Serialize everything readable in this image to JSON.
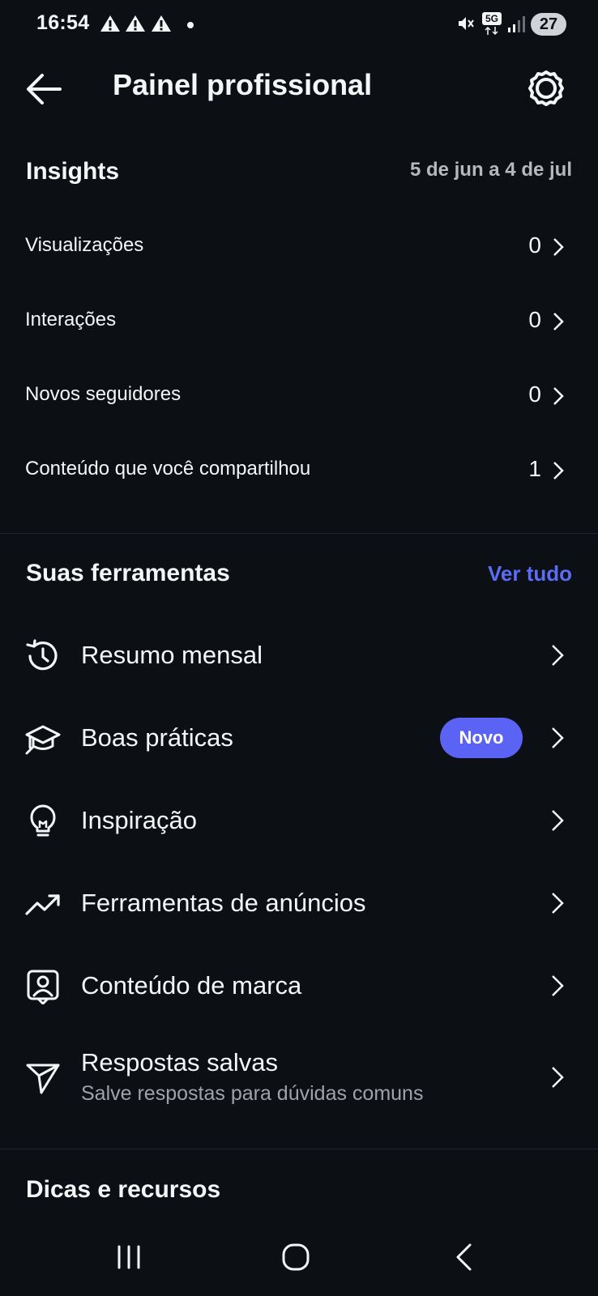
{
  "status_bar": {
    "time": "16:54",
    "network_label": "5G",
    "battery": "27"
  },
  "header": {
    "title": "Painel profissional"
  },
  "insights": {
    "title": "Insights",
    "date_range": "5 de jun a 4 de jul",
    "rows": [
      {
        "label": "Visualizações",
        "value": "0"
      },
      {
        "label": "Interações",
        "value": "0"
      },
      {
        "label": "Novos seguidores",
        "value": "0"
      },
      {
        "label": "Conteúdo que você compartilhou",
        "value": "1"
      }
    ]
  },
  "tools": {
    "title": "Suas ferramentas",
    "see_all": "Ver tudo",
    "items": [
      {
        "label": "Resumo mensal",
        "icon": "history-icon"
      },
      {
        "label": "Boas práticas",
        "icon": "graduation-cap-icon",
        "badge": "Novo"
      },
      {
        "label": "Inspiração",
        "icon": "lightbulb-icon"
      },
      {
        "label": "Ferramentas de anúncios",
        "icon": "trending-up-icon"
      },
      {
        "label": "Conteúdo de marca",
        "icon": "branded-content-icon"
      },
      {
        "label": "Respostas salvas",
        "sublabel": "Salve respostas para dúvidas comuns",
        "icon": "send-icon"
      }
    ]
  },
  "tips": {
    "title": "Dicas e recursos"
  },
  "colors": {
    "background": "#0c0f14",
    "accent": "#5b63f5",
    "link": "#5b6cf5",
    "secondary_text": "#9fa3a9"
  }
}
